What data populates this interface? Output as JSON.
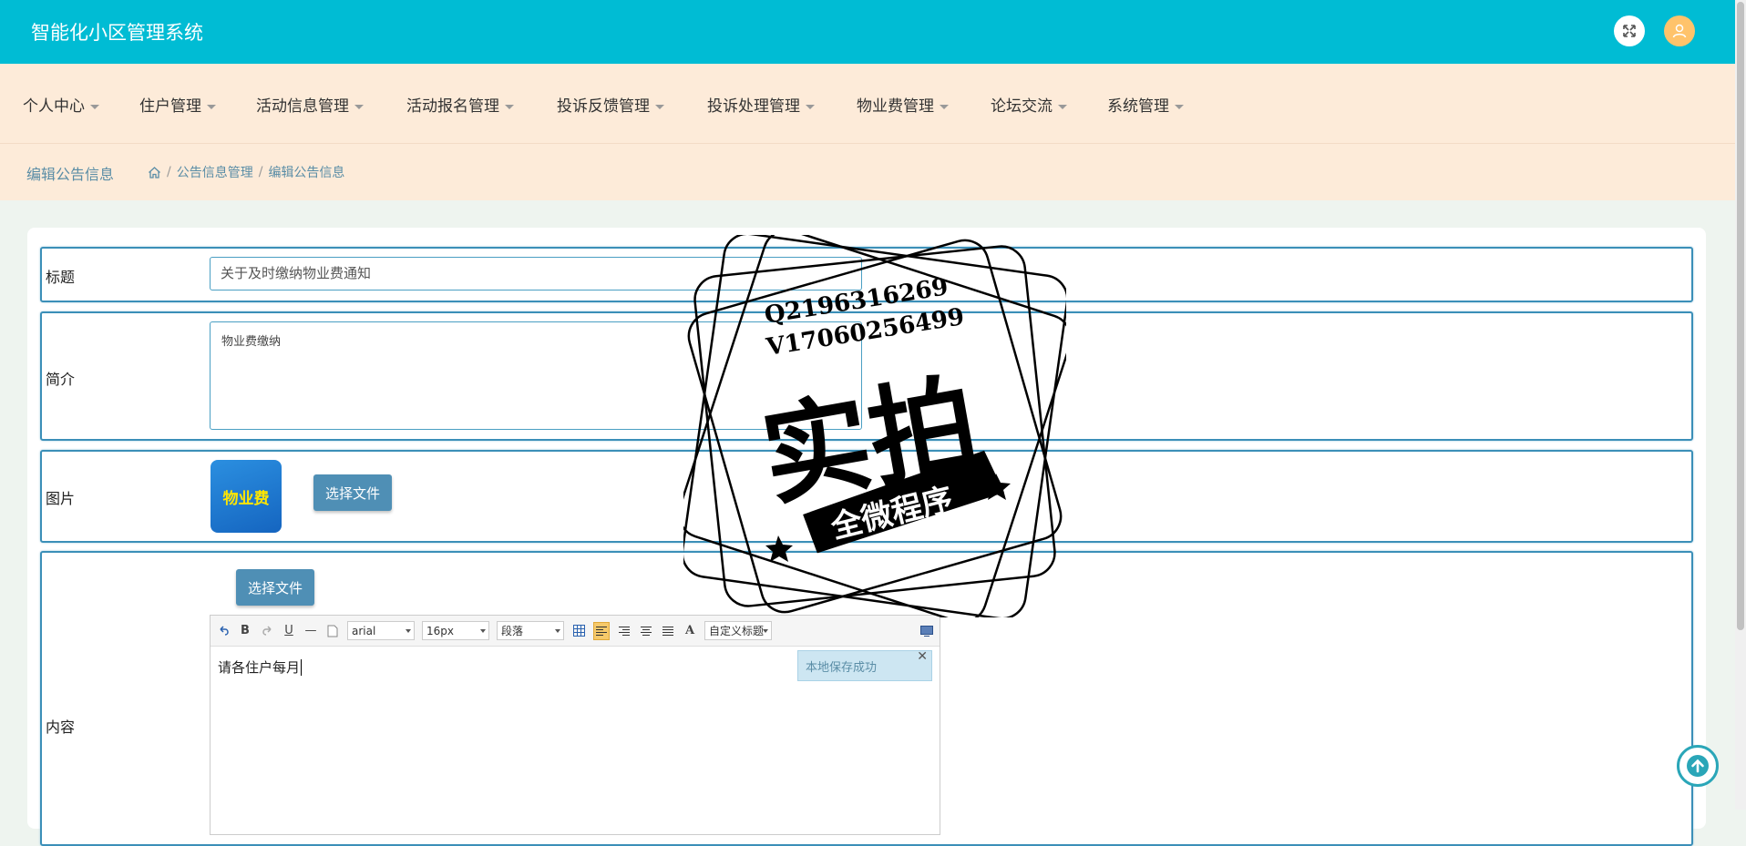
{
  "app": {
    "title": "智能化小区管理系统"
  },
  "nav": {
    "items": [
      {
        "label": "个人中心"
      },
      {
        "label": "住户管理"
      },
      {
        "label": "活动信息管理"
      },
      {
        "label": "活动报名管理"
      },
      {
        "label": "投诉反馈管理"
      },
      {
        "label": "投诉处理管理"
      },
      {
        "label": "物业费管理"
      },
      {
        "label": "论坛交流"
      },
      {
        "label": "系统管理"
      }
    ]
  },
  "breadcrumb": {
    "page_title": "编辑公告信息",
    "items": [
      "公告信息管理",
      "编辑公告信息"
    ],
    "separator": "/"
  },
  "form": {
    "title_label": "标题",
    "title_value": "关于及时缴纳物业费通知",
    "summary_label": "简介",
    "summary_value": "物业费缴纳",
    "image_label": "图片",
    "image_thumb_text": "物业费",
    "choose_file_label": "选择文件",
    "content_label": "内容",
    "content_choose_file_label": "选择文件"
  },
  "editor": {
    "font_family": "arial",
    "font_size": "16px",
    "paragraph": "段落",
    "custom_heading": "自定义标题",
    "content": "请各住户每月",
    "toast": "本地保存成功"
  },
  "watermark": {
    "line1": "Q2196316269",
    "line2": "V17060256499",
    "main": "实拍",
    "banner": "全微程序"
  },
  "colors": {
    "header": "#00bcd4",
    "nav_bg": "#fdebd9",
    "accent": "#4f8fb5",
    "border": "#3b8fb8"
  }
}
